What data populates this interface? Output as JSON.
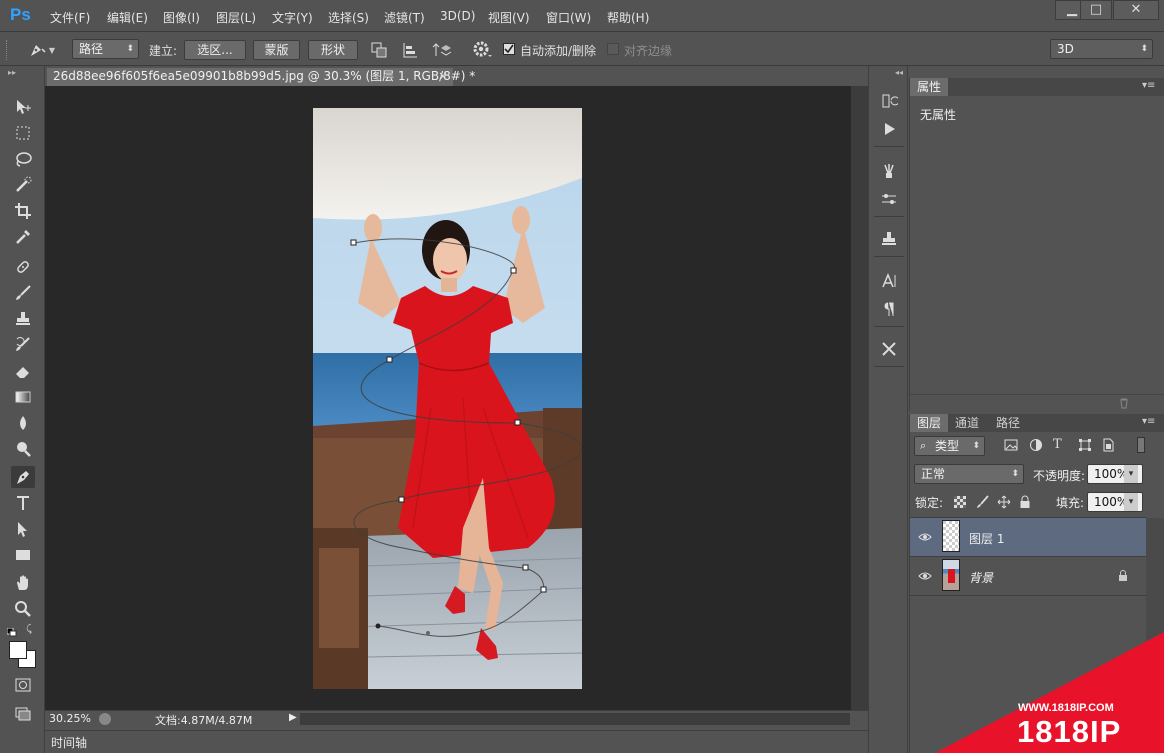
{
  "app": {
    "logo": "Ps"
  },
  "menu": [
    "文件(F)",
    "编辑(E)",
    "图像(I)",
    "图层(L)",
    "文字(Y)",
    "选择(S)",
    "滤镜(T)",
    "3D(D)",
    "视图(V)",
    "窗口(W)",
    "帮助(H)"
  ],
  "window_controls": {
    "minimize": "▁",
    "maximize": "□",
    "close": "✕"
  },
  "options": {
    "mode": "路径",
    "build_label": "建立:",
    "selection_btn": "选区...",
    "mask_btn": "蒙版",
    "shape_btn": "形状",
    "auto_add_delete": "自动添加/删除",
    "auto_add_delete_checked": true,
    "align_edges": "对齐边缘",
    "align_edges_checked": false,
    "workspace": "3D"
  },
  "document": {
    "tab_title": "26d88ee96f605f6ea5e09901b8b99d5.jpg @ 30.3% (图层 1, RGB/8#) *",
    "tab_close": "×",
    "zoom": "30.25%",
    "doc_size": "文档:4.87M/4.87M",
    "timeline_label": "时间轴"
  },
  "tools": [
    "move-icon",
    "marquee-icon",
    "lasso-icon",
    "quick-selection-icon",
    "crop-icon",
    "eyedropper-icon",
    "healing-brush-icon",
    "brush-icon",
    "clone-stamp-icon",
    "history-brush-icon",
    "eraser-icon",
    "gradient-icon",
    "blur-icon",
    "dodge-icon",
    "pen-icon",
    "type-icon",
    "path-selection-icon",
    "rectangle-icon",
    "hand-icon",
    "zoom-icon",
    "color-swatches",
    "quick-mask-icon",
    "screen-mode-icon"
  ],
  "properties": {
    "tab": "属性",
    "content": "无属性"
  },
  "layers_panel": {
    "tabs": [
      "图层",
      "通道",
      "路径"
    ],
    "filter_kind": "类型",
    "blend_mode": "正常",
    "opacity_label": "不透明度:",
    "opacity": "100%",
    "lock_label": "锁定:",
    "fill_label": "填充:",
    "fill": "100%",
    "layers": [
      {
        "name": "图层 1",
        "selected": true
      },
      {
        "name": "背景",
        "selected": false,
        "locked": true
      }
    ]
  },
  "watermark": {
    "url": "WWW.1818IP.COM",
    "brand": "1818IP"
  },
  "colors": {
    "accent": "#2fa3ff",
    "selection": "#5d6a80",
    "dress": "#d9141c"
  }
}
